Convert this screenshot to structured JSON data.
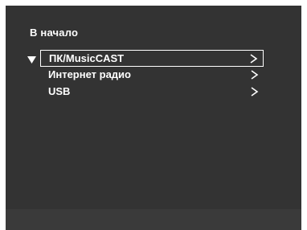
{
  "screen": {
    "title": "В начало"
  },
  "menu": {
    "items": [
      {
        "label": "ПК/MusicCAST",
        "icon": "chevron-right-icon",
        "selected": true
      },
      {
        "label": "Интернет радио",
        "icon": "chevron-right-icon",
        "selected": false
      },
      {
        "label": "USB",
        "icon": "chevron-right-icon",
        "selected": false
      }
    ]
  },
  "cursor_icon": "triangle-down-icon",
  "colors": {
    "background": "#333333",
    "text": "#ffffff"
  }
}
